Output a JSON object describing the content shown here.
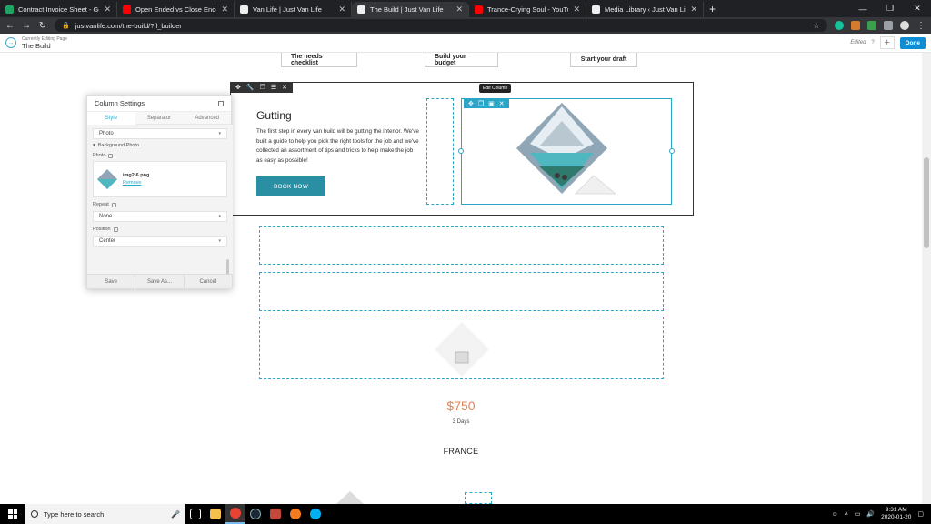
{
  "browser": {
    "tabs": [
      {
        "title": "Contract Invoice Sheet - Google",
        "color": "#21a463",
        "active": false
      },
      {
        "title": "Open Ended vs Close Ended Prob",
        "color": "#ff0000",
        "active": false
      },
      {
        "title": "Van Life | Just Van Life",
        "color": "#eeeeee",
        "active": false
      },
      {
        "title": "The Build | Just Van Life",
        "color": "#eeeeee",
        "active": true
      },
      {
        "title": "Trance-Crying Soul - YouTub",
        "color": "#ff0000",
        "active": false
      },
      {
        "title": "Media Library ‹ Just Van Life — W",
        "color": "#eeeeee",
        "active": false
      }
    ],
    "url": "justvanlife.com/the-build/?fl_builder"
  },
  "builder": {
    "editing_label": "Currently Editing Page",
    "page_name": "The Build",
    "edited": "Edited",
    "done": "Done"
  },
  "page": {
    "buttons": [
      "The needs checklist",
      "Build your budget",
      "Start your draft"
    ],
    "gutting_title": "Gutting",
    "gutting_text": "The first step in every van build will be gutting the interior. We've built a guide to help you pick the right tools for the job and we've collected an assortment of tips and tricks to help make the job as easy as possible!",
    "book_now": "BOOK NOW",
    "edit_column_tooltip": "Edit Column",
    "price": "$750",
    "days": "3 Days",
    "country": "FRANCE"
  },
  "panel": {
    "title": "Column Settings",
    "tabs": [
      "Style",
      "Separator",
      "Advanced"
    ],
    "active_tab": "Style",
    "type_value": "Photo",
    "section": "Background Photo",
    "photo_label": "Photo",
    "photo_name": "img2-6.png",
    "remove": "Remove",
    "repeat_label": "Repeat",
    "repeat_value": "None",
    "position_label": "Position",
    "position_value": "Center",
    "save": "Save",
    "save_as": "Save As...",
    "cancel": "Cancel"
  },
  "taskbar": {
    "search_placeholder": "Type here to search",
    "time": "9:31 AM",
    "date": "2020-01-20"
  }
}
